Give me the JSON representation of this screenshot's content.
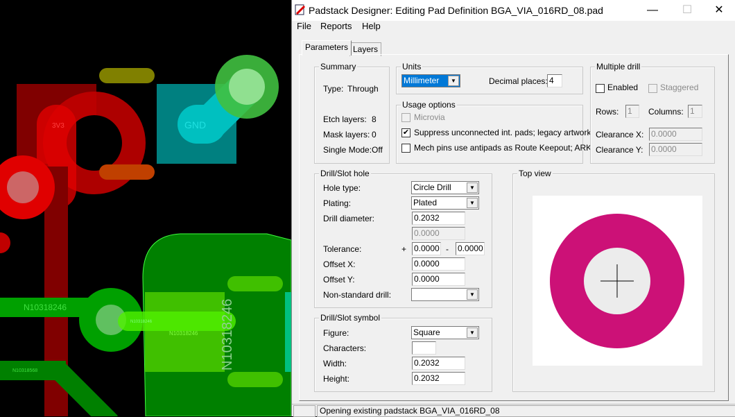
{
  "pcb": {
    "labels": {
      "gnd": "GND",
      "net1": "N10318246",
      "net2": "N10318246",
      "net3": "N10318246",
      "net4": "N10318246",
      "net5": "N10318568",
      "rail": "3V3"
    }
  },
  "window": {
    "title": "Padstack Designer: Editing Pad Definition BGA_VIA_016RD_08.pad",
    "minimize": "—",
    "maximize": "☐",
    "close": "✕"
  },
  "menu": [
    "File",
    "Reports",
    "Help"
  ],
  "tabs": [
    {
      "label": "Parameters",
      "active": true
    },
    {
      "label": "Layers",
      "active": false
    }
  ],
  "summary": {
    "title": "Summary",
    "type_label": "Type:",
    "type_value": "Through",
    "etch_label": "Etch layers:",
    "etch_value": "8",
    "mask_label": "Mask layers:",
    "mask_value": "0",
    "single_label": "Single Mode:",
    "single_value": "Off"
  },
  "units": {
    "title": "Units",
    "unit": "Millimeter",
    "decimal_label": "Decimal places:",
    "decimal_value": "4"
  },
  "usage": {
    "title": "Usage options",
    "options": [
      {
        "label": "Microvia",
        "checked": false,
        "enabled": false
      },
      {
        "label": "Suppress unconnected int. pads; legacy artwork",
        "checked": true,
        "enabled": true
      },
      {
        "label": "Mech pins use antipads as Route Keepout; ARK",
        "checked": false,
        "enabled": true
      }
    ]
  },
  "multiple_drill": {
    "title": "Multiple drill",
    "enabled_label": "Enabled",
    "staggered_label": "Staggered",
    "rows_label": "Rows:",
    "rows_value": "1",
    "columns_label": "Columns:",
    "columns_value": "1",
    "clearance_x_label": "Clearance X:",
    "clearance_x_value": "0.0000",
    "clearance_y_label": "Clearance Y:",
    "clearance_y_value": "0.0000"
  },
  "drill_hole": {
    "title": "Drill/Slot hole",
    "hole_type_label": "Hole type:",
    "hole_type": "Circle Drill",
    "plating_label": "Plating:",
    "plating": "Plated",
    "diameter_label": "Drill diameter:",
    "diameter": "0.2032",
    "diameter2": "0.0000",
    "tolerance_label": "Tolerance:",
    "plus": "+",
    "minus": "-",
    "tol_plus": "0.0000",
    "tol_minus": "0.0000",
    "offset_x_label": "Offset X:",
    "offset_x": "0.0000",
    "offset_y_label": "Offset Y:",
    "offset_y": "0.0000",
    "nonstd_label": "Non-standard drill:",
    "nonstd": ""
  },
  "drill_symbol": {
    "title": "Drill/Slot symbol",
    "figure_label": "Figure:",
    "figure": "Square",
    "characters_label": "Characters:",
    "characters": "",
    "width_label": "Width:",
    "width": "0.2032",
    "height_label": "Height:",
    "height": "0.2032"
  },
  "top_view": {
    "title": "Top view",
    "pad_color": "#cc1177",
    "hole_color": "#ececec"
  },
  "status": {
    "message": "Opening existing padstack BGA_VIA_016RD_08"
  }
}
